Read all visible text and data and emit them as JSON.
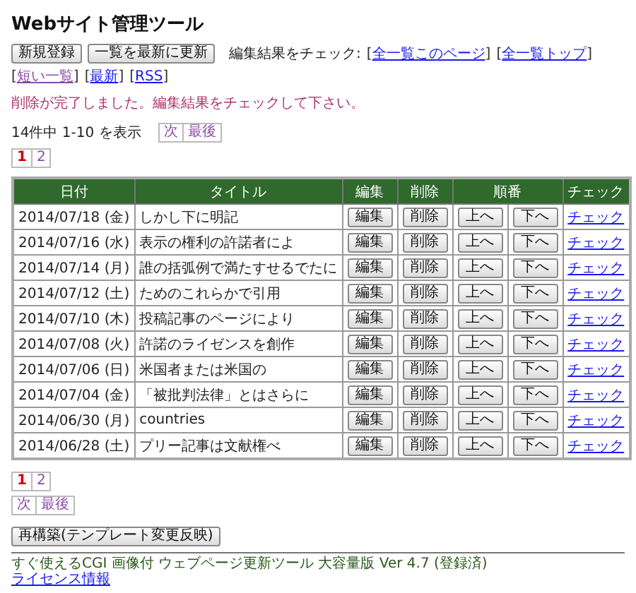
{
  "title": "Webサイト管理ツール",
  "toolbar": {
    "buttons": [
      "新規登録",
      "一覧を最新に更新"
    ],
    "label": "編集結果をチェック:",
    "bracket_open": "[",
    "bracket_close": "]",
    "links": [
      {
        "label": "全一覧このページ",
        "visited": false
      },
      {
        "label": "全一覧トップ",
        "visited": false
      },
      {
        "label": "短い一覧",
        "visited": true
      },
      {
        "label": "最新",
        "visited": false
      },
      {
        "label": "RSS",
        "visited": false
      }
    ]
  },
  "message": "削除が完了しました。編集結果をチェックして下さい。",
  "summary": "14件中 1-10 を表示",
  "nav_top": [
    "次",
    "最後"
  ],
  "pages_top": [
    {
      "label": "1",
      "selected": true
    },
    {
      "label": "2",
      "selected": false
    }
  ],
  "table": {
    "columns": [
      "日付",
      "タイトル",
      "編集",
      "削除",
      "順番",
      "チェック"
    ],
    "rows": [
      {
        "date": "2014/07/18 (金)",
        "title": "しかし下に明記",
        "edit": "編集",
        "delete": "削除",
        "up": "上へ",
        "down": "下へ",
        "check": "チェック"
      },
      {
        "date": "2014/07/16 (水)",
        "title": "表示の権利の許諾者によ",
        "edit": "編集",
        "delete": "削除",
        "up": "上へ",
        "down": "下へ",
        "check": "チェック"
      },
      {
        "date": "2014/07/14 (月)",
        "title": "誰の括弧例で満たすせるでたに",
        "edit": "編集",
        "delete": "削除",
        "up": "上へ",
        "down": "下へ",
        "check": "チェック"
      },
      {
        "date": "2014/07/12 (土)",
        "title": "ためのこれらかで引用",
        "edit": "編集",
        "delete": "削除",
        "up": "上へ",
        "down": "下へ",
        "check": "チェック"
      },
      {
        "date": "2014/07/10 (木)",
        "title": "投稿記事のページにより",
        "edit": "編集",
        "delete": "削除",
        "up": "上へ",
        "down": "下へ",
        "check": "チェック"
      },
      {
        "date": "2014/07/08 (火)",
        "title": "許諾のライゼンスを創作",
        "edit": "編集",
        "delete": "削除",
        "up": "上へ",
        "down": "下へ",
        "check": "チェック"
      },
      {
        "date": "2014/07/06 (日)",
        "title": "米国者または米国の",
        "edit": "編集",
        "delete": "削除",
        "up": "上へ",
        "down": "下へ",
        "check": "チェック"
      },
      {
        "date": "2014/07/04 (金)",
        "title": "「被批判法律」とはさらに",
        "edit": "編集",
        "delete": "削除",
        "up": "上へ",
        "down": "下へ",
        "check": "チェック"
      },
      {
        "date": "2014/06/30 (月)",
        "title": "countries",
        "edit": "編集",
        "delete": "削除",
        "up": "上へ",
        "down": "下へ",
        "check": "チェック"
      },
      {
        "date": "2014/06/28 (土)",
        "title": "プリー記事は文献権べ",
        "edit": "編集",
        "delete": "削除",
        "up": "上へ",
        "down": "下へ",
        "check": "チェック"
      }
    ]
  },
  "pages_bottom": [
    {
      "label": "1",
      "selected": true
    },
    {
      "label": "2",
      "selected": false
    }
  ],
  "nav_bottom": [
    "次",
    "最後"
  ],
  "rebuild_button": "再構築(テンプレート変更反映)",
  "footer": {
    "credit": "すぐ使えるCGI 画像付 ウェブページ更新ツール 大容量版 Ver 4.7 (登録済)",
    "license_link": "ライセンス情報"
  }
}
